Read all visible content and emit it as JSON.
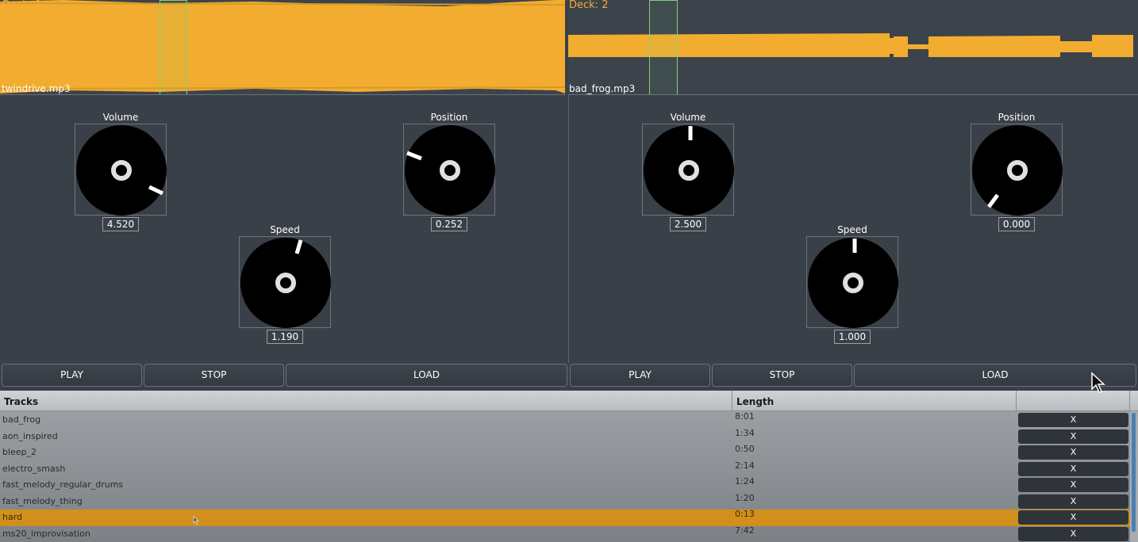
{
  "decks": [
    {
      "deck_label": "Deck: 1",
      "file": "twindrive.mp3",
      "knobs": {
        "volume": {
          "label": "Volume",
          "value": "4.520"
        },
        "position": {
          "label": "Position",
          "value": "0.252"
        },
        "speed": {
          "label": "Speed",
          "value": "1.190"
        }
      },
      "buttons": {
        "play": "PLAY",
        "stop": "STOP",
        "load": "LOAD"
      }
    },
    {
      "deck_label": "Deck: 2",
      "file": "bad_frog.mp3",
      "knobs": {
        "volume": {
          "label": "Volume",
          "value": "2.500"
        },
        "position": {
          "label": "Position",
          "value": "0.000"
        },
        "speed": {
          "label": "Speed",
          "value": "1.000"
        }
      },
      "buttons": {
        "play": "PLAY",
        "stop": "STOP",
        "load": "LOAD"
      }
    }
  ],
  "table": {
    "headers": {
      "tracks": "Tracks",
      "length": "Length"
    },
    "remove_label": "X",
    "rows": [
      {
        "name": "bad_frog",
        "length": "8:01"
      },
      {
        "name": "aon_inspired",
        "length": "1:34"
      },
      {
        "name": "bleep_2",
        "length": "0:50"
      },
      {
        "name": "electro_smash",
        "length": "2:14"
      },
      {
        "name": "fast_melody_regular_drums",
        "length": "1:24"
      },
      {
        "name": "fast_melody_thing",
        "length": "1:20"
      },
      {
        "name": "hard",
        "length": "0:13"
      },
      {
        "name": "ms20_improvisation",
        "length": "7:42"
      }
    ],
    "selected_index": 6
  },
  "colors": {
    "accent": "#f2ad30",
    "background": "#3a4048",
    "selected_row": "#d38f1c"
  }
}
